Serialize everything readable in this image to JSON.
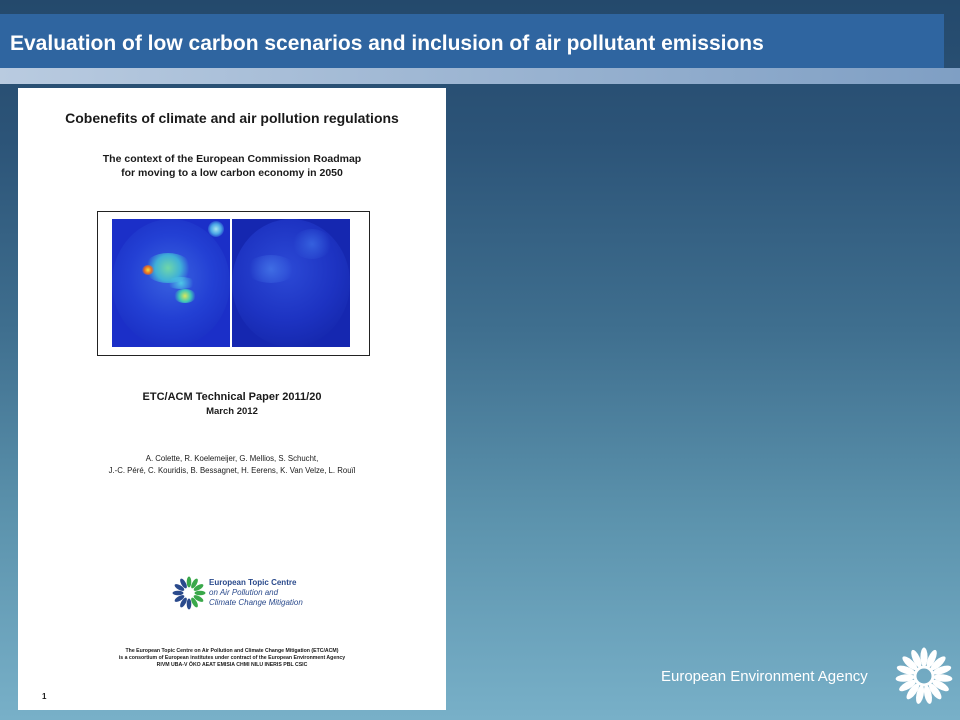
{
  "header": {
    "title": "Evaluation of low carbon scenarios and inclusion of air pollutant emissions"
  },
  "document": {
    "title": "Cobenefits of climate and air pollution regulations",
    "subtitle_line1": "The context of the European Commission Roadmap",
    "subtitle_line2": "for moving to a low carbon economy in 2050",
    "paper_id": "ETC/ACM Technical Paper 2011/20",
    "date": "March 2012",
    "authors_line1": "A. Colette, R. Koelemeijer, G. Mellios, S. Schucht,",
    "authors_line2": "J.-C. Péré, C. Kouridis, B. Bessagnet, H. Eerens, K. Van Velze, L. Rouïl",
    "etc_line1": "European Topic Centre",
    "etc_line2": "on Air Pollution and",
    "etc_line3": "Climate Change Mitigation",
    "footer_line1": "The European Topic Centre on Air Pollution and Climate Change Mitigation (ETC/ACM)",
    "footer_line2": "is a consortium of European institutes under contract of the European Environment Agency",
    "footer_line3": "RIVM UBA-V ÖKO AEAT EMISIA CHMI NILU INERIS PBL CSIC",
    "page_number": "1"
  },
  "footer": {
    "agency_name": "European Environment Agency"
  },
  "icons": {
    "etc_logo": "sunflower-logo-icon",
    "agency_logo": "sunflower-logo-icon"
  },
  "colors": {
    "title_bar": "#2f65a0",
    "etc_blue": "#2a4a8c",
    "etc_green": "#3aa84a"
  }
}
